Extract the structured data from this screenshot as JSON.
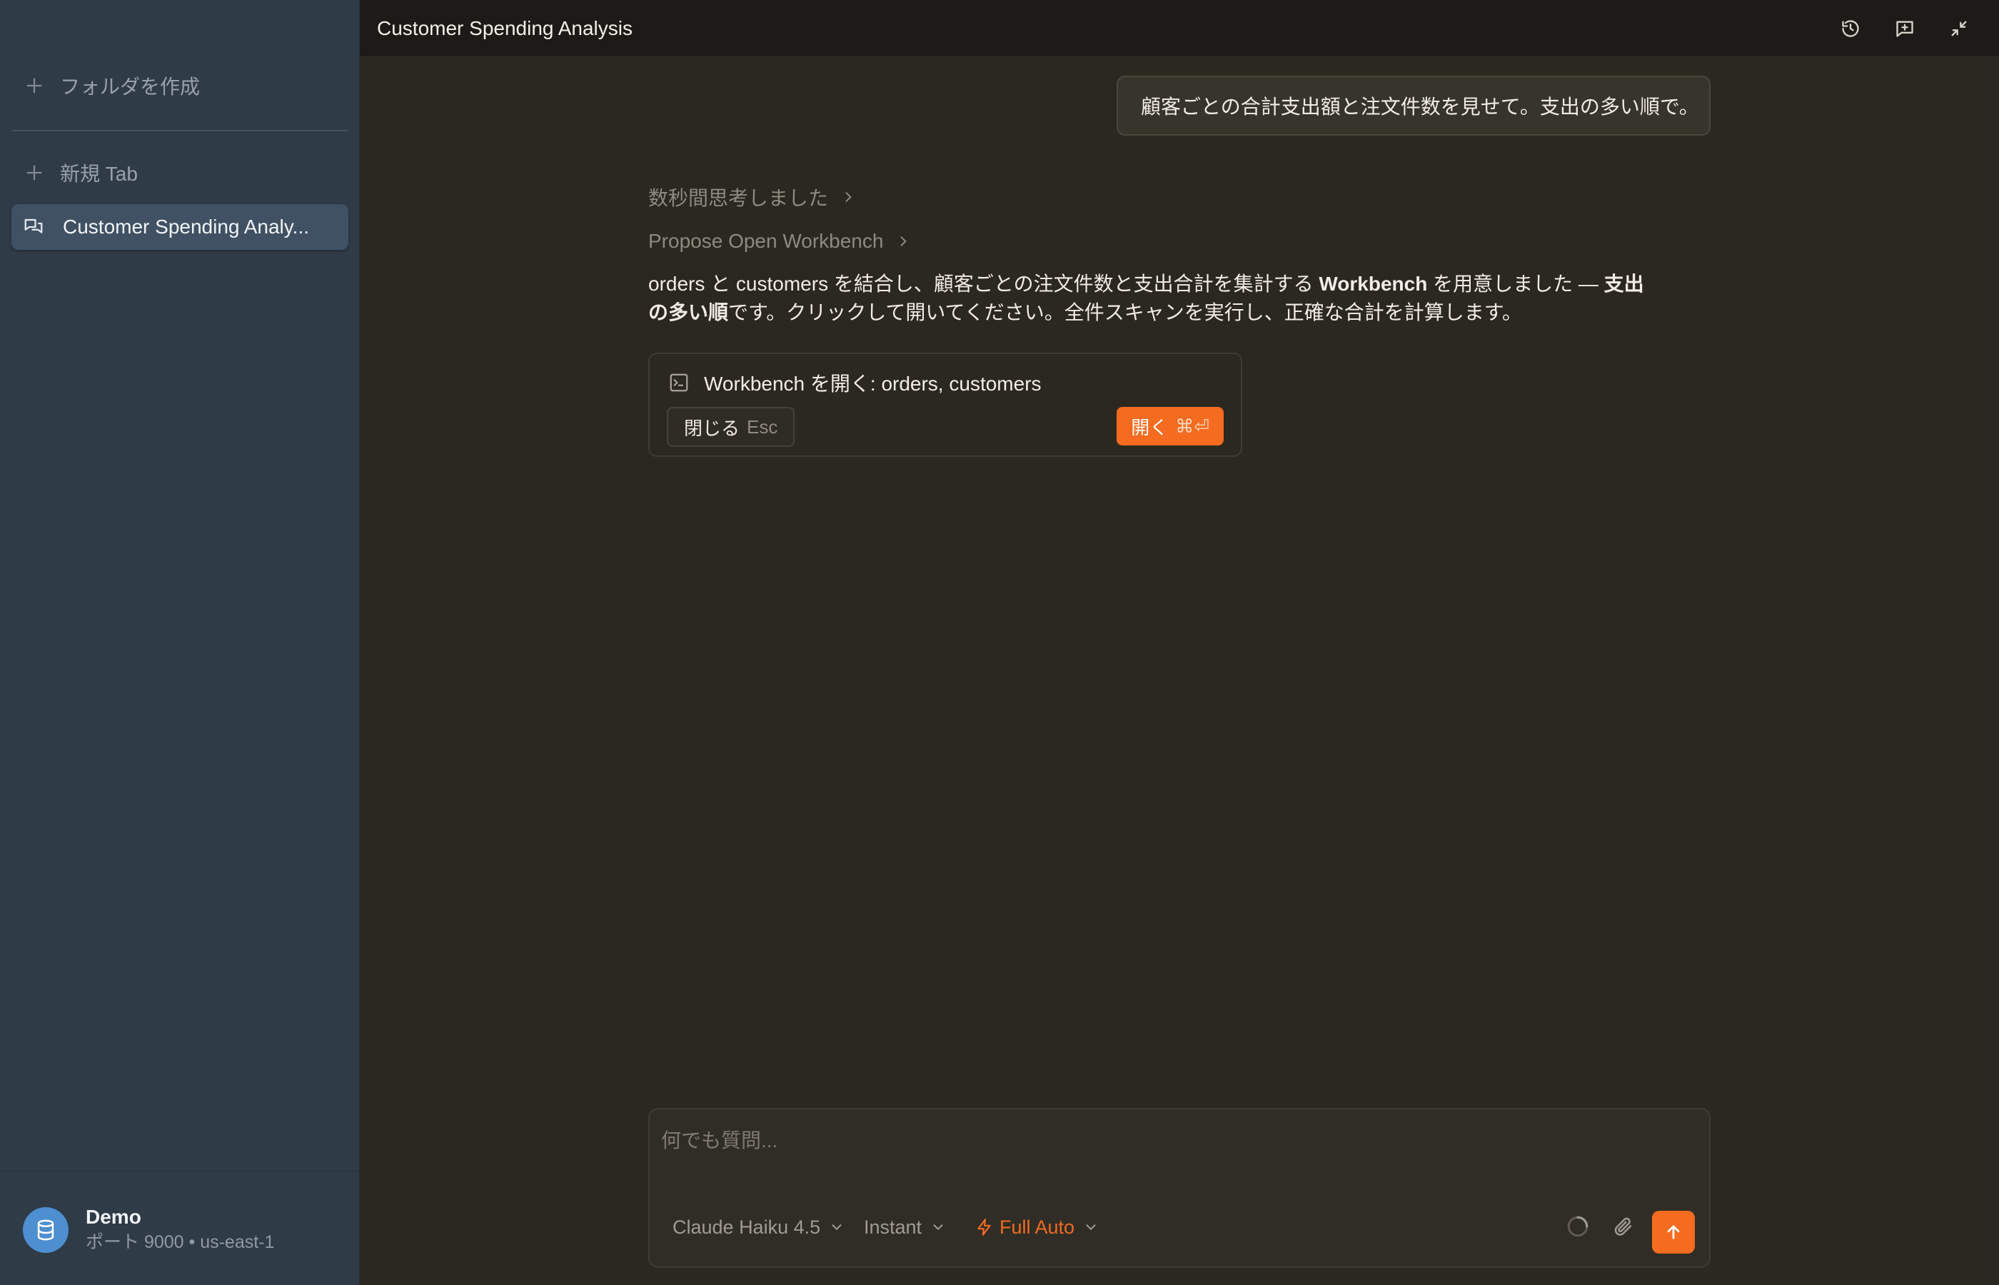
{
  "sidebar": {
    "create_folder_label": "フォルダを作成",
    "new_tab_label": "新規 Tab",
    "active_item_label": "Customer Spending Analy...",
    "account": {
      "name": "Demo",
      "subtitle": "ポート 9000 • us-east-1"
    }
  },
  "header": {
    "title": "Customer Spending Analysis",
    "icons": [
      "history-icon",
      "new-chat-icon",
      "collapse-icon"
    ]
  },
  "chat": {
    "user_message": "顧客ごとの合計支出額と注文件数を見せて。支出の多い順で。",
    "thinking_label": "数秒間思考しました",
    "tool_label": "Propose Open Workbench",
    "assistant_parts": {
      "p1": "orders と customers を結合し、顧客ごとの注文件数と支出合計を集計する ",
      "b1": "Workbench",
      "p2": " を用意しました — ",
      "b2": "支出の多い順",
      "p3": "です。クリックして開いてください。全件スキャンを実行し、正確な合計を計算します。"
    },
    "proposal": {
      "title": "Workbench を開く: orders, customers",
      "close_label": "閉じる",
      "close_shortcut": "Esc",
      "open_label": "開く",
      "open_shortcut": "⌘⏎"
    }
  },
  "composer": {
    "placeholder": "何でも質問...",
    "model": "Claude Haiku 4.5",
    "speed": "Instant",
    "mode": "Full Auto"
  },
  "colors": {
    "accent": "#f56b1f",
    "sidebar_bg": "#2f3b47",
    "main_bg": "#2b2820"
  }
}
